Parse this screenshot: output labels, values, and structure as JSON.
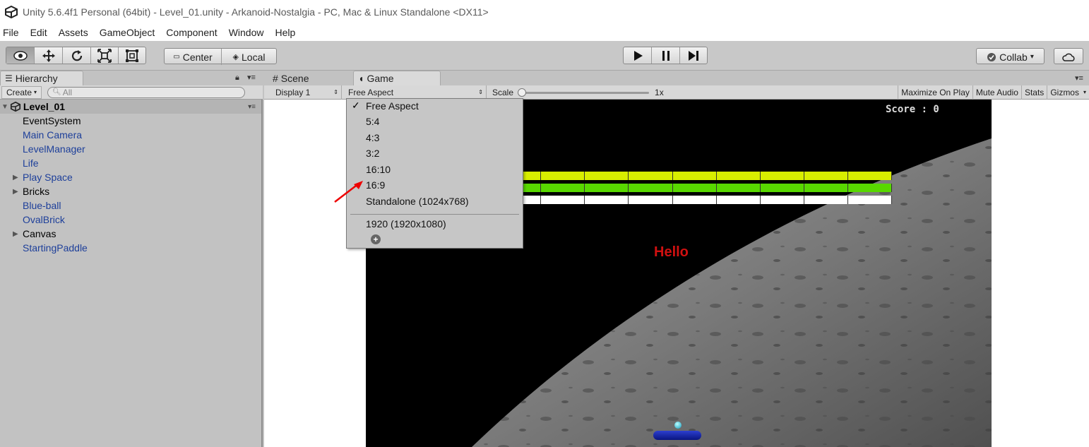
{
  "window": {
    "title": "Unity 5.6.4f1 Personal (64bit) - Level_01.unity - Arkanoid-Nostalgia - PC, Mac & Linux Standalone <DX11>",
    "icon": "unity-logo-icon"
  },
  "menu": [
    "File",
    "Edit",
    "Assets",
    "GameObject",
    "Component",
    "Window",
    "Help"
  ],
  "toolbar": {
    "tools": [
      "view-eye-icon",
      "move-icon",
      "rotate-icon",
      "scale-icon",
      "rect-icon"
    ],
    "pivot_center": "Center",
    "pivot_local": "Local",
    "play_controls": [
      "play-icon",
      "pause-icon",
      "step-icon"
    ],
    "collab": "Collab",
    "collab_arrow": "▾",
    "cloud": "cloud-icon"
  },
  "hierarchy": {
    "tab": "Hierarchy",
    "create": "Create",
    "search_placeholder": "All",
    "scene": "Level_01",
    "items": [
      {
        "label": "EventSystem",
        "color": "#000000",
        "expandable": false
      },
      {
        "label": "Main Camera",
        "color": "#1d3f9a",
        "expandable": false
      },
      {
        "label": "LevelManager",
        "color": "#1d3f9a",
        "expandable": false
      },
      {
        "label": "Life",
        "color": "#1d3f9a",
        "expandable": false
      },
      {
        "label": "Play Space",
        "color": "#1d3f9a",
        "expandable": true
      },
      {
        "label": "Bricks",
        "color": "#000000",
        "expandable": true
      },
      {
        "label": "Blue-ball",
        "color": "#1d3f9a",
        "expandable": false
      },
      {
        "label": "OvalBrick",
        "color": "#1d3f9a",
        "expandable": false
      },
      {
        "label": "Canvas",
        "color": "#000000",
        "expandable": true
      },
      {
        "label": "StartingPaddle",
        "color": "#1d3f9a",
        "expandable": false
      }
    ]
  },
  "tabs": {
    "scene": "Scene",
    "game": "Game"
  },
  "gamebar": {
    "display": "Display 1",
    "aspect": "Free Aspect",
    "scale_label": "Scale",
    "scale_value": "1x",
    "maximize": "Maximize On Play",
    "mute": "Mute Audio",
    "stats": "Stats",
    "gizmos": "Gizmos"
  },
  "game": {
    "score": "Score : 0",
    "hello": "Hello",
    "brick_rows": [
      {
        "color": "#d8ee00"
      },
      {
        "color": "#58d800"
      },
      {
        "color": "#ffffff"
      }
    ]
  },
  "aspect_dropdown": {
    "items": [
      "Free Aspect",
      "5:4",
      "4:3",
      "3:2",
      "16:10",
      "16:9",
      "Standalone (1024x768)"
    ],
    "custom": [
      "1920 (1920x1080)"
    ],
    "selected": "Free Aspect",
    "add_icon": "plus-circle-icon"
  }
}
